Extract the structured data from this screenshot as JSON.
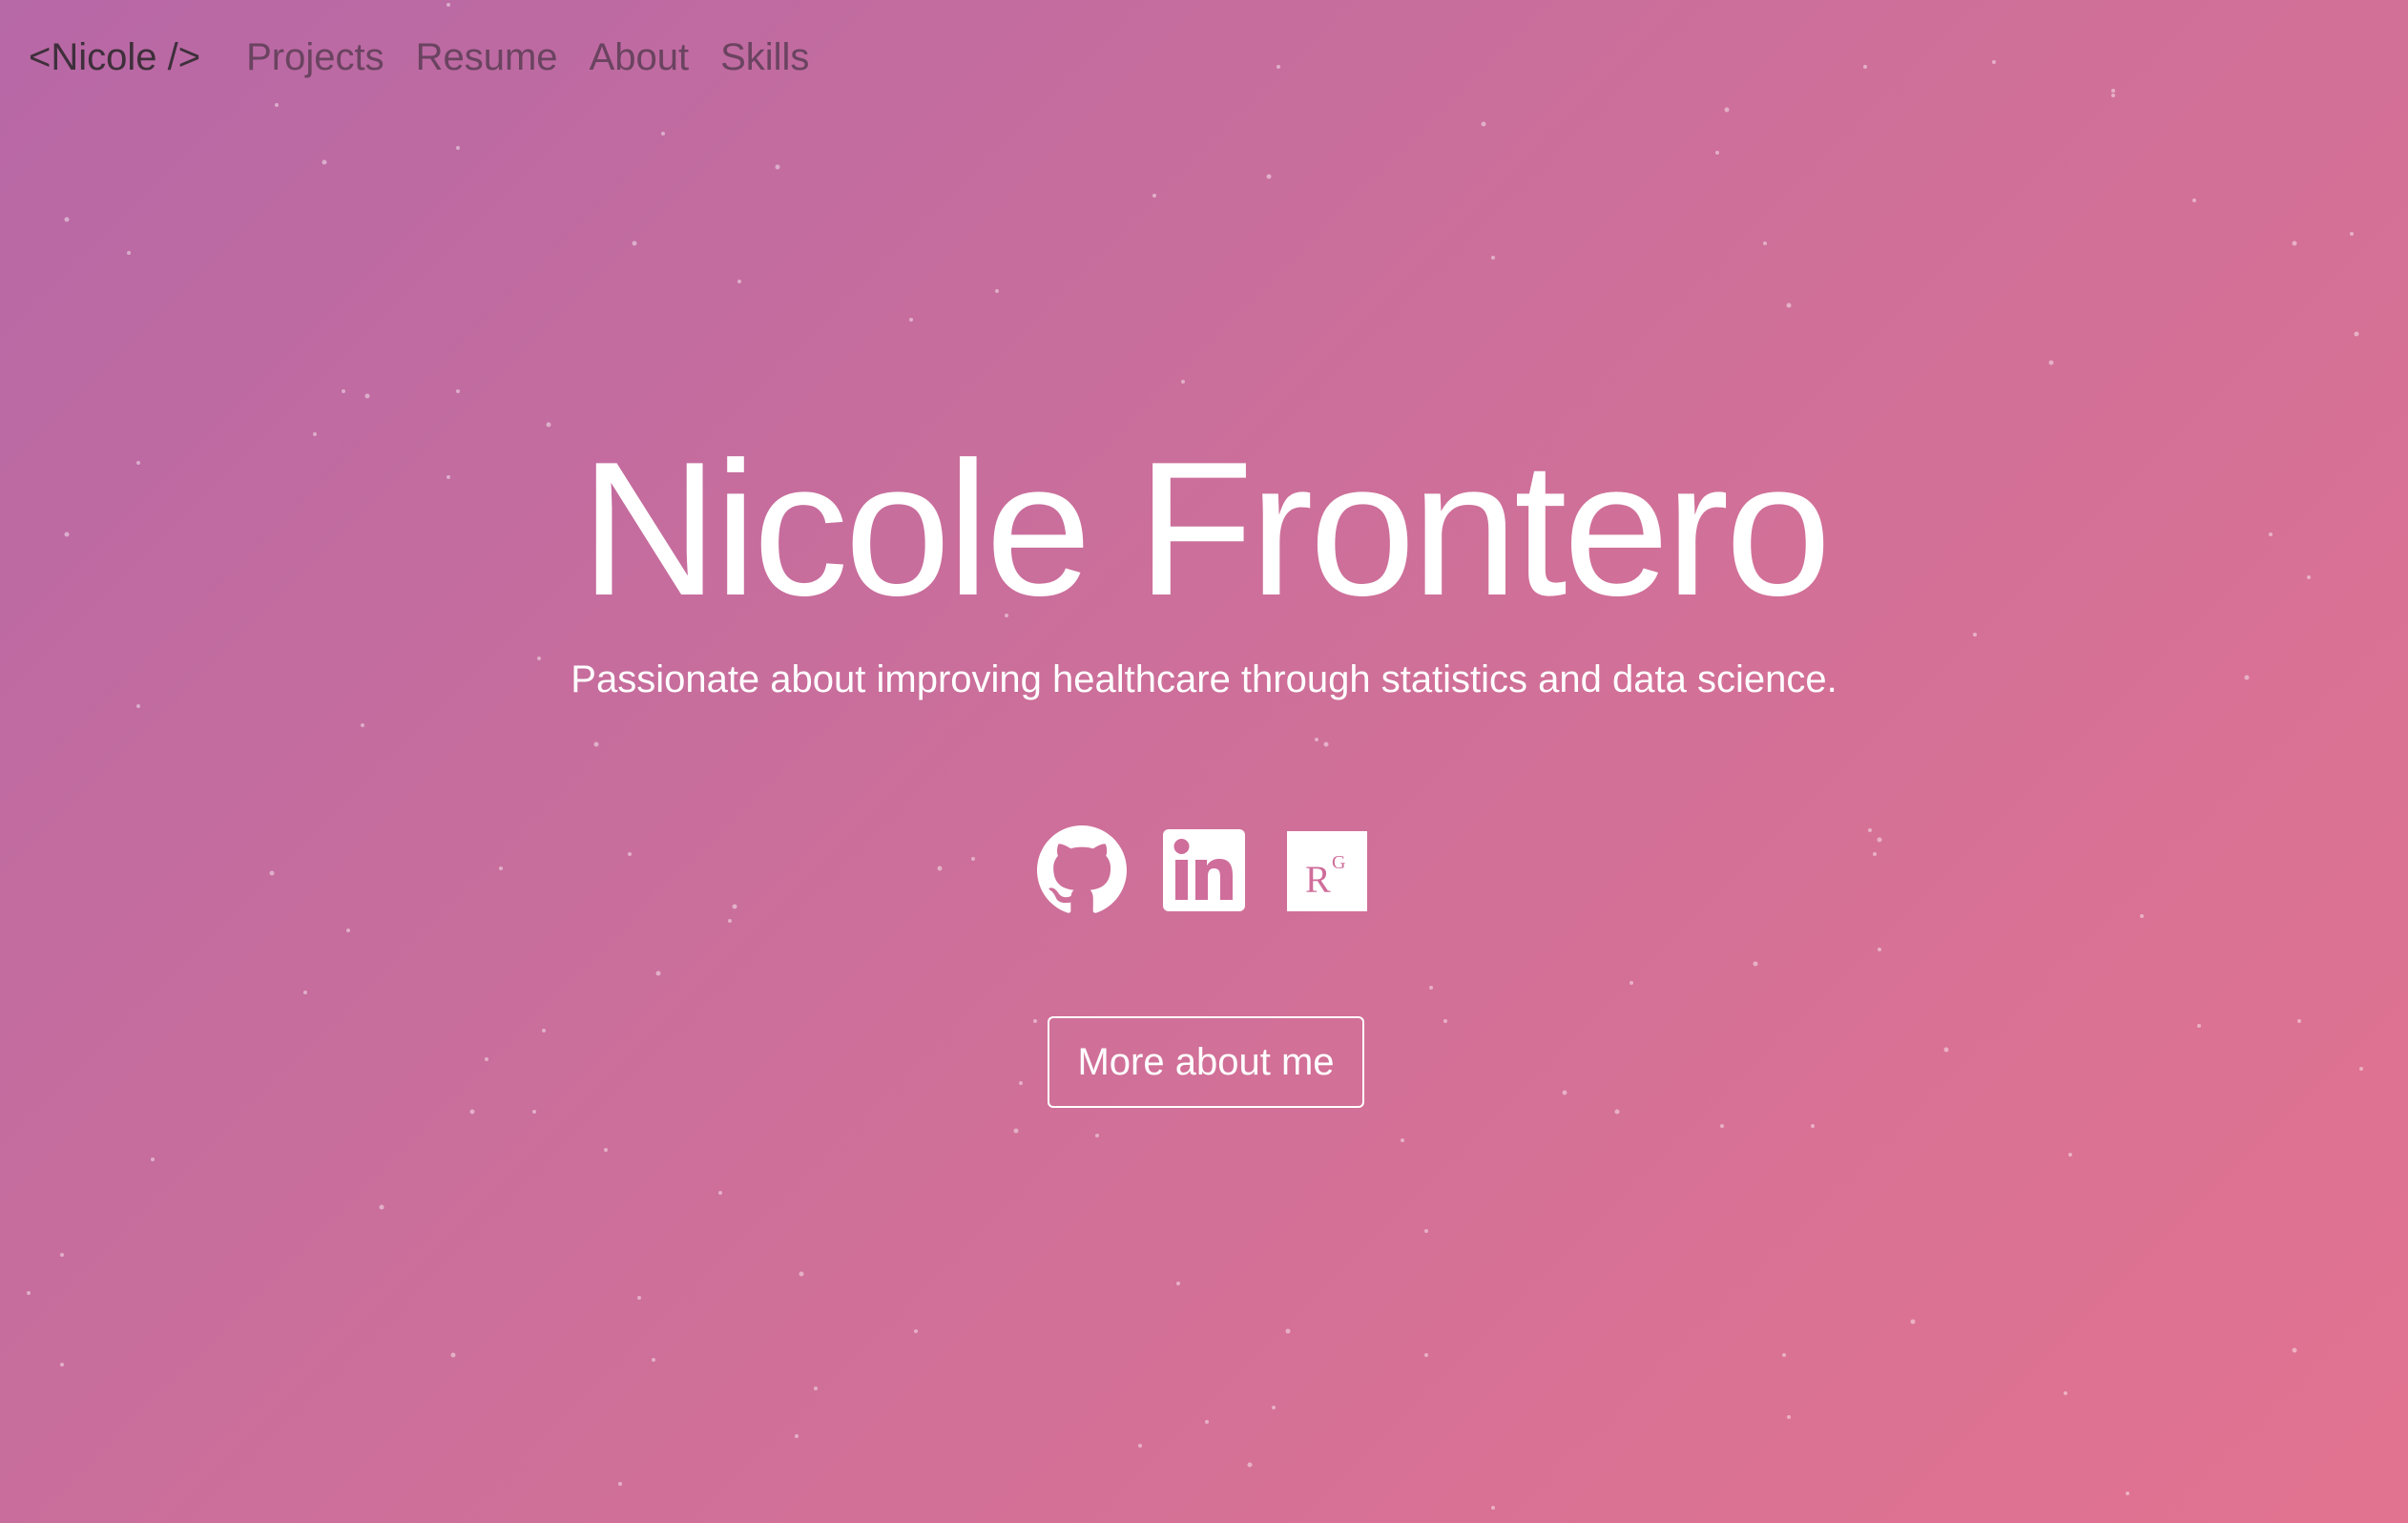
{
  "nav": {
    "brand": "<Nicole />",
    "links": [
      "Projects",
      "Resume",
      "About",
      "Skills"
    ]
  },
  "hero": {
    "title": "Nicole Frontero",
    "subtitle": "Passionate about improving healthcare through statistics and data science.",
    "cta_label": "More about me"
  },
  "social": [
    {
      "icon": "github-icon"
    },
    {
      "icon": "linkedin-icon"
    },
    {
      "icon": "researchgate-icon",
      "label": "RG"
    }
  ],
  "colors": {
    "gradient_start": "#b768a6",
    "gradient_end": "#e27390",
    "text": "#ffffff",
    "brand": "#3e2f3b",
    "nav_link": "#6a4360"
  }
}
